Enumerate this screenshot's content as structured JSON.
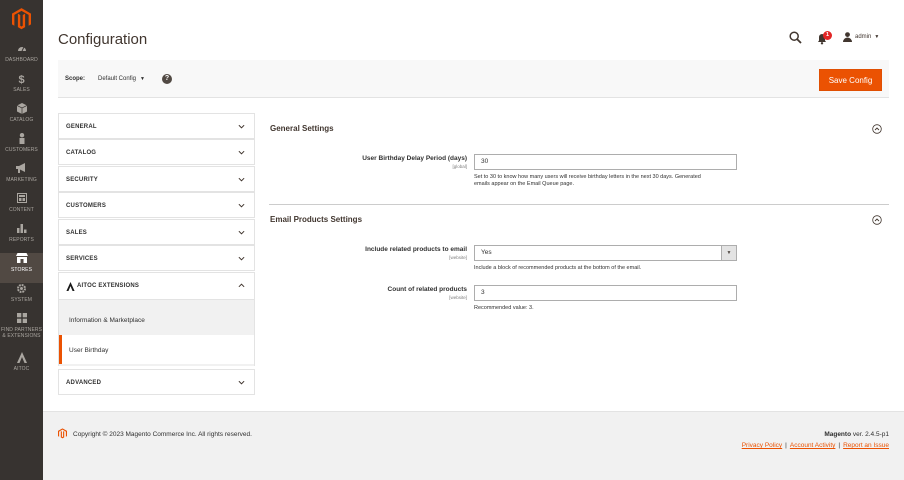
{
  "sidebar": {
    "items": [
      {
        "label": "DASHBOARD",
        "icon": "dashboard-icon"
      },
      {
        "label": "SALES",
        "icon": "dollar-icon"
      },
      {
        "label": "CATALOG",
        "icon": "cube-icon"
      },
      {
        "label": "CUSTOMERS",
        "icon": "person-icon"
      },
      {
        "label": "MARKETING",
        "icon": "megaphone-icon"
      },
      {
        "label": "CONTENT",
        "icon": "layout-icon"
      },
      {
        "label": "REPORTS",
        "icon": "bar-chart-icon"
      },
      {
        "label": "STORES",
        "icon": "store-icon"
      },
      {
        "label": "SYSTEM",
        "icon": "gear-icon"
      },
      {
        "label1": "FIND PARTNERS",
        "label2": "& EXTENSIONS",
        "icon": "blocks-icon"
      },
      {
        "label": "AITOC",
        "icon": "aitoc-icon"
      }
    ]
  },
  "header": {
    "title": "Configuration",
    "notifications_count": "1",
    "user": "admin"
  },
  "scope": {
    "label": "Scope:",
    "value": "Default Config",
    "help": "?"
  },
  "actions": {
    "save": "Save Config"
  },
  "tabs": {
    "general": "GENERAL",
    "catalog": "CATALOG",
    "security": "SECURITY",
    "customers": "CUSTOMERS",
    "sales": "SALES",
    "services": "SERVICES",
    "aitoc": "AITOC EXTENSIONS",
    "aitoc_items": [
      "Information & Marketplace",
      "User Birthday"
    ],
    "advanced": "ADVANCED"
  },
  "general_settings": {
    "title": "General Settings",
    "delay_label": "User Birthday Delay Period (days)",
    "delay_scope": "[global]",
    "delay_value": "30",
    "delay_note1": "Set to 30 to know how many users will receive birthday letters in the next 30 days. Generated",
    "delay_note2": "emails appear on the Email Queue page."
  },
  "email_settings": {
    "title": "Email Products Settings",
    "include_label": "Include related products to email",
    "include_scope": "[website]",
    "include_value": "Yes",
    "include_note": "Include a block of recommended products at the bottom of the email.",
    "count_label": "Count of related products",
    "count_scope": "[website]",
    "count_value": "3",
    "count_note": "Recommended value: 3."
  },
  "footer": {
    "copyright": "Copyright © 2023 Magento Commerce Inc. All rights reserved.",
    "brand": "Magento",
    "version": " ver. 2.4.5-p1",
    "links": [
      "Privacy Policy",
      "Account Activity",
      "Report an Issue"
    ],
    "separator": "|"
  },
  "colors": {
    "accent": "#eb5202",
    "sidebar": "#373330",
    "sidebar_active": "#514943"
  }
}
